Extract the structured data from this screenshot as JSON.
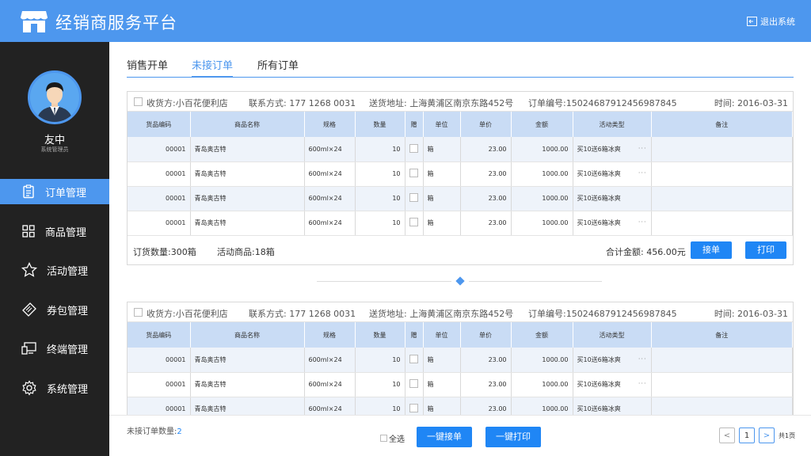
{
  "header": {
    "title": "经销商服务平台",
    "logout_label": "退出系统"
  },
  "user": {
    "name": "友中",
    "role": "系统管理员"
  },
  "nav": [
    {
      "label": "订单管理",
      "icon": "clipboard-icon",
      "active": true
    },
    {
      "label": "商品管理",
      "icon": "grid-icon",
      "active": false
    },
    {
      "label": "活动管理",
      "icon": "star-icon",
      "active": false
    },
    {
      "label": "券包管理",
      "icon": "ticket-icon",
      "active": false
    },
    {
      "label": "终端管理",
      "icon": "devices-icon",
      "active": false
    },
    {
      "label": "系统管理",
      "icon": "gear-icon",
      "active": false
    }
  ],
  "tabs": [
    {
      "label": "销售开单",
      "active": false
    },
    {
      "label": "未接订单",
      "active": true
    },
    {
      "label": "所有订单",
      "active": false
    }
  ],
  "columns": [
    "货品编码",
    "商品名称",
    "规格",
    "数量",
    "赠",
    "单位",
    "单价",
    "金额",
    "活动类型",
    "备注"
  ],
  "orders": [
    {
      "receiver": "收货方:小百花便利店",
      "contact": "联系方式: 177 1268 0031",
      "address": "送货地址: 上海黄浦区南京东路452号",
      "order_no": "订单编号:15024687912456987845",
      "time": "时间: 2016-03-31",
      "rows": [
        {
          "code": "00001",
          "name": "青岛奥古特",
          "spec": "600ml×24",
          "qty": "10",
          "unit": "箱",
          "price": "23.00",
          "amount": "1000.00",
          "activity": "买10送6箱冰爽",
          "more": "···"
        },
        {
          "code": "00001",
          "name": "青岛奥古特",
          "spec": "600ml×24",
          "qty": "10",
          "unit": "箱",
          "price": "23.00",
          "amount": "1000.00",
          "activity": "买10送6箱冰爽",
          "more": "···"
        },
        {
          "code": "00001",
          "name": "青岛奥古特",
          "spec": "600ml×24",
          "qty": "10",
          "unit": "箱",
          "price": "23.00",
          "amount": "1000.00",
          "activity": "买10送6箱冰爽",
          "more": ""
        },
        {
          "code": "00001",
          "name": "青岛奥古特",
          "spec": "600ml×24",
          "qty": "10",
          "unit": "箱",
          "price": "23.00",
          "amount": "1000.00",
          "activity": "买10送6箱冰爽",
          "more": "···"
        }
      ],
      "order_qty": "订货数量:300箱",
      "promo_items": "活动商品:18箱",
      "total": "合计金额: 456.00元",
      "accept_label": "接单",
      "print_label": "打印"
    },
    {
      "receiver": "收货方:小百花便利店",
      "contact": "联系方式: 177 1268 0031",
      "address": "送货地址: 上海黄浦区南京东路452号",
      "order_no": "订单编号:15024687912456987845",
      "time": "时间: 2016-03-31",
      "rows": [
        {
          "code": "00001",
          "name": "青岛奥古特",
          "spec": "600ml×24",
          "qty": "10",
          "unit": "箱",
          "price": "23.00",
          "amount": "1000.00",
          "activity": "买10送6箱冰爽",
          "more": "···"
        },
        {
          "code": "00001",
          "name": "青岛奥古特",
          "spec": "600ml×24",
          "qty": "10",
          "unit": "箱",
          "price": "23.00",
          "amount": "1000.00",
          "activity": "买10送6箱冰爽",
          "more": "···"
        },
        {
          "code": "00001",
          "name": "青岛奥古特",
          "spec": "600ml×24",
          "qty": "10",
          "unit": "箱",
          "price": "23.00",
          "amount": "1000.00",
          "activity": "买10送6箱冰爽",
          "more": ""
        }
      ]
    }
  ],
  "footer": {
    "pending_label": "未接订单数量:",
    "pending_count": "2",
    "select_all": "全选",
    "batch_accept": "一键接单",
    "batch_print": "一键打印",
    "prev": "<",
    "page": "1",
    "next": ">",
    "total_pages": "共1页"
  },
  "colors": {
    "accent": "#4d97ee",
    "sidebar": "#222222",
    "button": "#1f86f5",
    "table_header": "#c9dcf5"
  }
}
